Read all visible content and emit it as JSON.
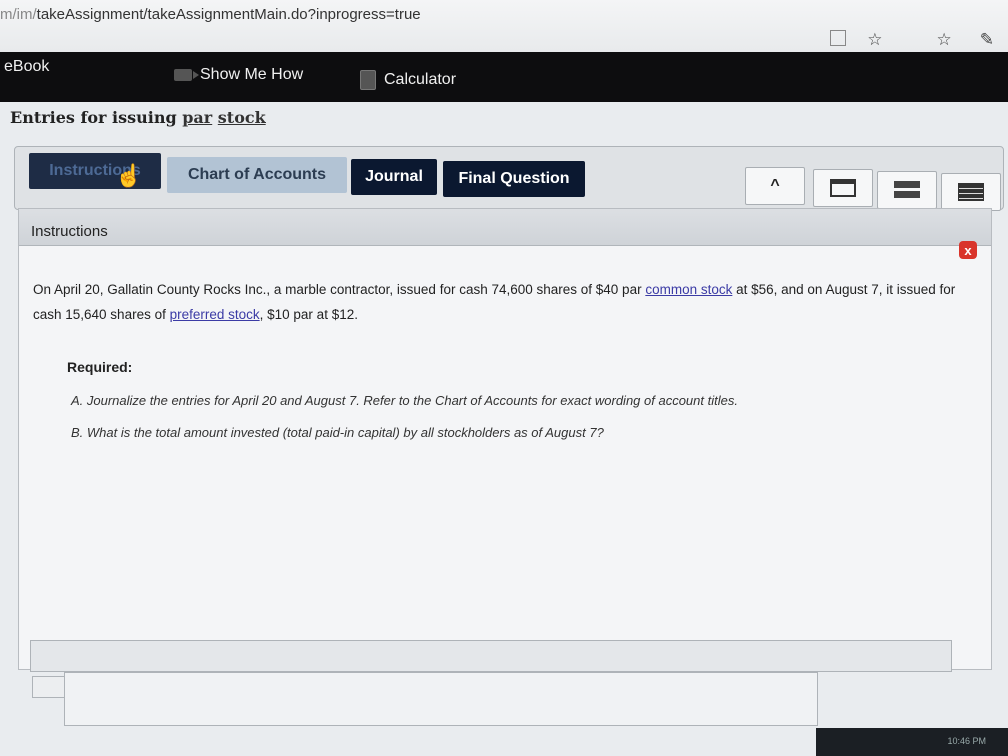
{
  "browser": {
    "url_prefix": "m/im/",
    "url_main": "takeAssignment/takeAssignmentMain.do?inprogress=true",
    "icons": [
      "reader-icon",
      "star-icon",
      "favorites-icon",
      "pen-icon"
    ]
  },
  "toolbar": {
    "ebook": "eBook",
    "show_me_how": "Show Me How",
    "calculator": "Calculator"
  },
  "title": {
    "prefix": "Entries for issuing ",
    "link1": "par",
    "link2": "stock"
  },
  "tabs": {
    "instructions": "Instructions",
    "chart_of_accounts": "Chart of Accounts",
    "journal": "Journal",
    "final_question": "Final Question"
  },
  "panel": {
    "header": "Instructions",
    "p1": "On April 20, Gallatin County Rocks Inc., a marble contractor, issued for cash 74,600 shares of $40 par ",
    "link_common": "common stock",
    "p2": " at $56, and on August 7, it issued for cash 15,640 shares of ",
    "link_preferred": "preferred stock",
    "p3": ", $10 par at $12.",
    "required": "Required:",
    "req_a": "A. Journalize the entries for April 20 and August 7. Refer to the Chart of Accounts for exact wording of account titles.",
    "req_b": "B. What is the total amount invested (total paid-in capital) by all stockholders as of August 7?"
  },
  "system": {
    "clock": "10:46 PM"
  }
}
